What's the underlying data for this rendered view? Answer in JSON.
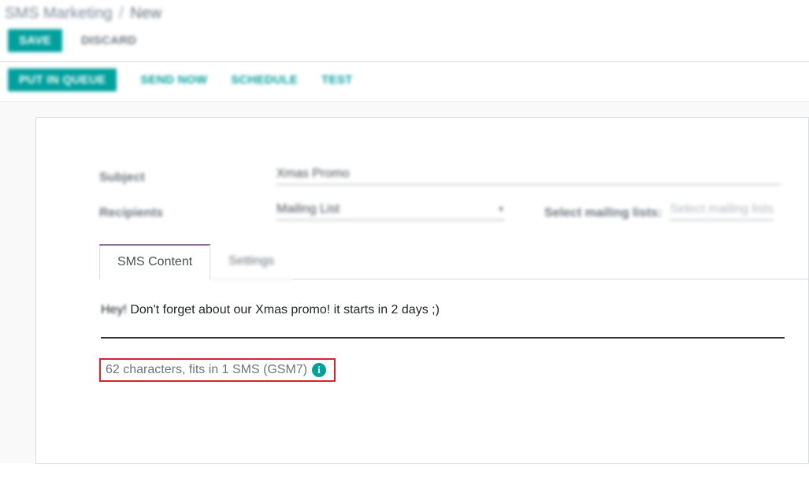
{
  "breadcrumb": {
    "root": "SMS Marketing",
    "current": "New"
  },
  "buttons": {
    "save": "SAVE",
    "discard": "DISCARD",
    "put_in_queue": "PUT IN QUEUE",
    "send_now": "SEND NOW",
    "schedule": "SCHEDULE",
    "test": "TEST"
  },
  "fields": {
    "subject_label": "Subject",
    "subject_value": "Xmas Promo",
    "recipients_label": "Recipients",
    "recipients_value": "Mailing List",
    "mailing_lists_label": "Select mailing lists:",
    "mailing_lists_placeholder": "Select mailing lists"
  },
  "tabs": {
    "sms_content": "SMS Content",
    "settings": "Settings"
  },
  "sms": {
    "prefix": "Hey!",
    "body_rest": " Don't forget about our Xmas promo! it starts in 2 days ;)",
    "counter": "62 characters, fits in 1 SMS (GSM7)"
  }
}
